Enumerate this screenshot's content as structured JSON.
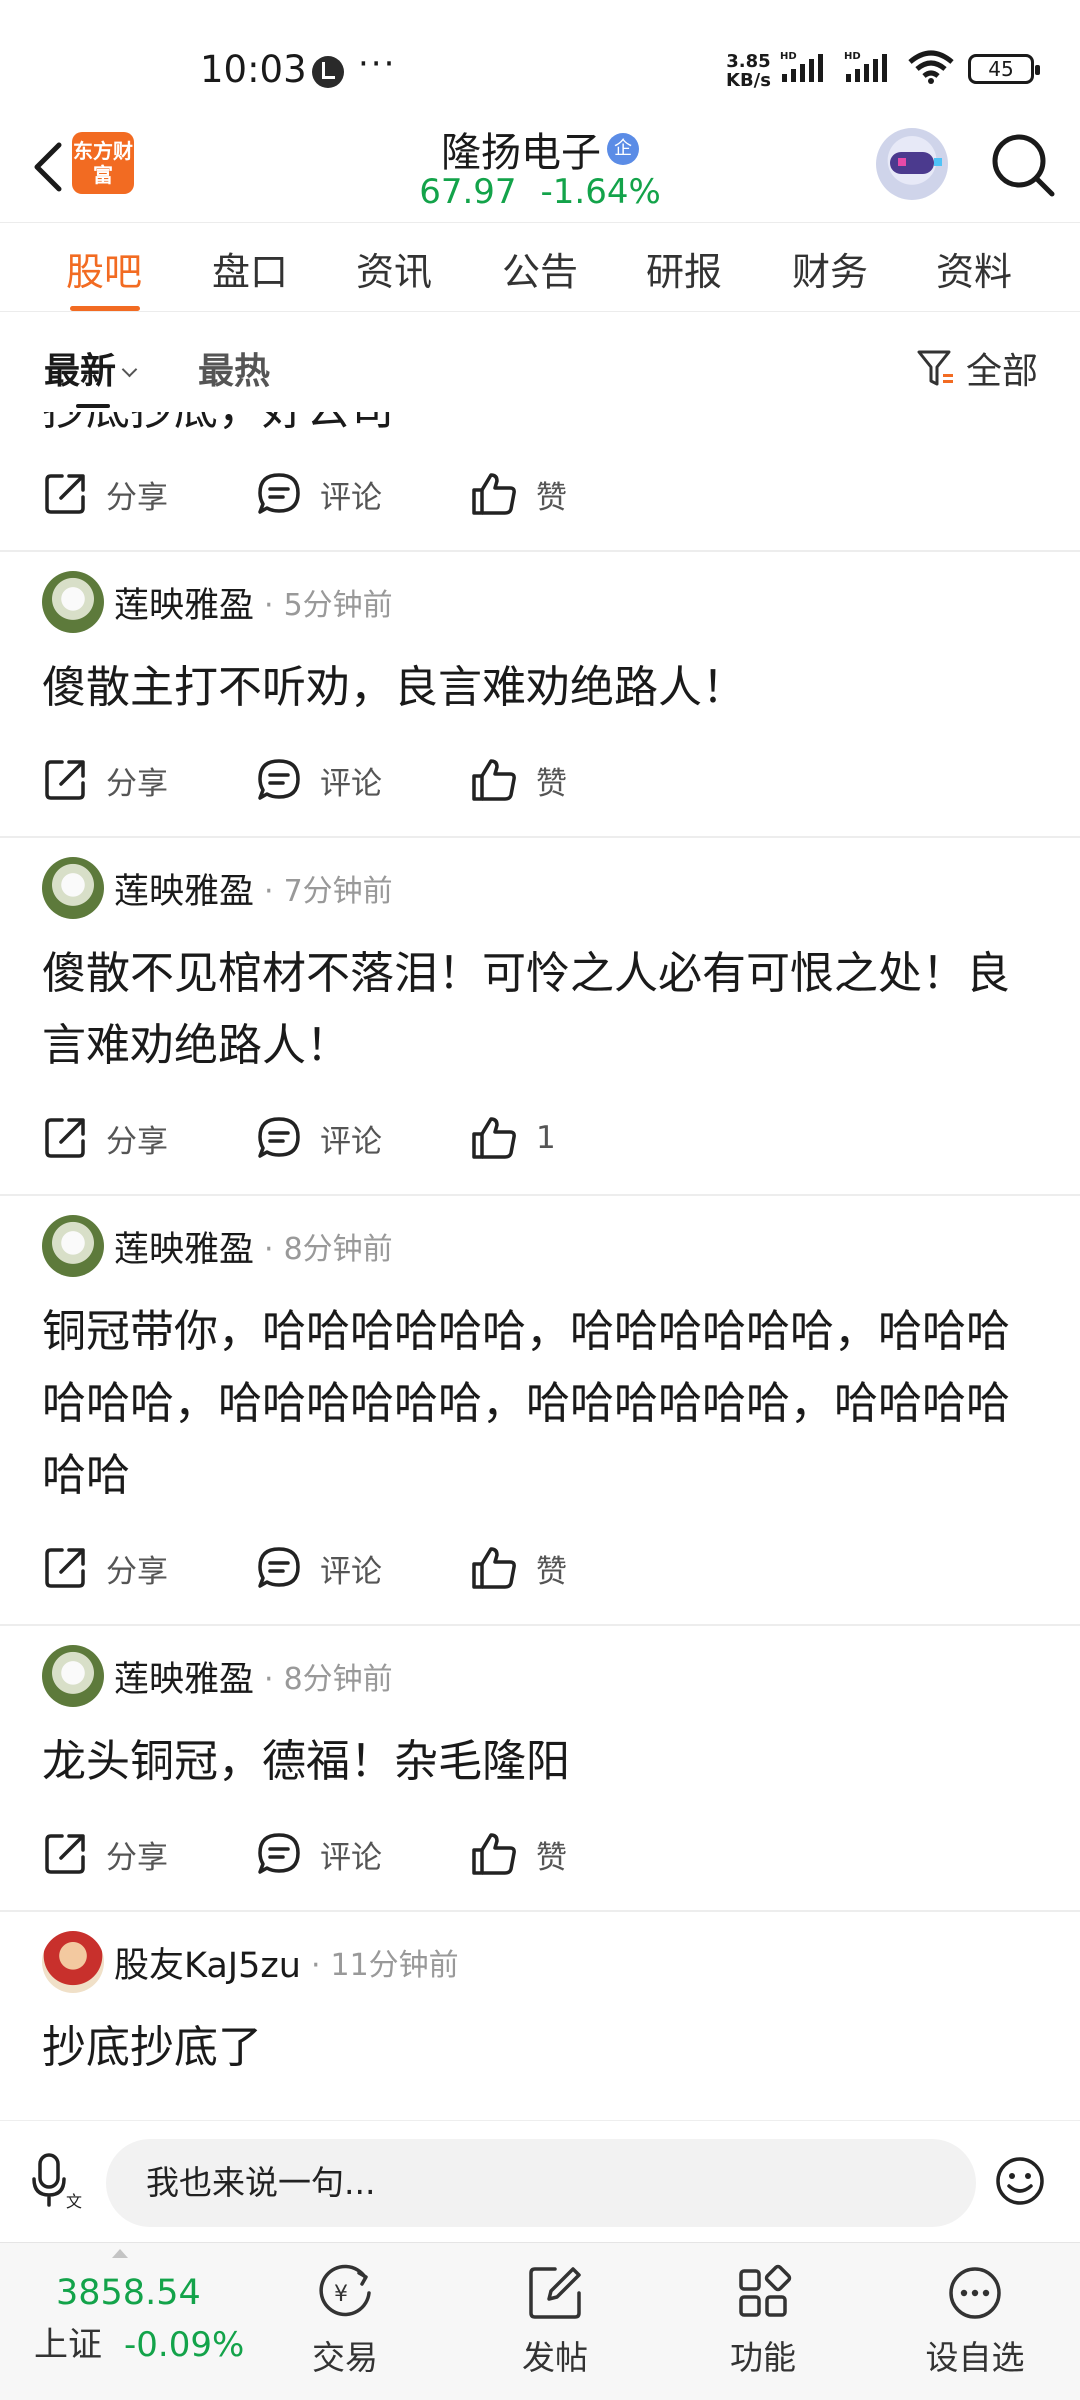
{
  "status_bar": {
    "time": "10:03",
    "more": "···",
    "speed_value": "3.85",
    "speed_unit": "KB/s",
    "battery": "45"
  },
  "header": {
    "logo_text": "东方财富",
    "stock_name": "隆扬电子",
    "badge": "企",
    "price": "67.97",
    "change": "-1.64%"
  },
  "tabs": [
    "股吧",
    "盘口",
    "资讯",
    "公告",
    "研报",
    "财务",
    "资料"
  ],
  "sort": {
    "latest": "最新",
    "hottest": "最热",
    "filter": "全部"
  },
  "actions": {
    "share": "分享",
    "comment": "评论",
    "like": "赞"
  },
  "posts": [
    {
      "author": "",
      "time": "",
      "body": "抄底抄底，好公司",
      "likes": "赞"
    },
    {
      "author": "莲映雅盈",
      "time": "5分钟前",
      "body": "傻散主打不听劝，良言难劝绝路人！",
      "likes": "赞"
    },
    {
      "author": "莲映雅盈",
      "time": "7分钟前",
      "body": "傻散不见棺材不落泪！可怜之人必有可恨之处！良言难劝绝路人！",
      "likes": "1"
    },
    {
      "author": "莲映雅盈",
      "time": "8分钟前",
      "body": "铜冠带你，哈哈哈哈哈哈，哈哈哈哈哈哈，哈哈哈哈哈哈，哈哈哈哈哈哈，哈哈哈哈哈哈，哈哈哈哈哈哈",
      "likes": "赞"
    },
    {
      "author": "莲映雅盈",
      "time": "8分钟前",
      "body": "龙头铜冠，德福！杂毛隆阳",
      "likes": "赞"
    },
    {
      "author": "股友KaJ5zu",
      "time": "11分钟前",
      "body": "抄底抄底了",
      "likes": "赞"
    }
  ],
  "comment_bar": {
    "placeholder": "我也来说一句..."
  },
  "bottom_nav": {
    "index_value": "3858.54",
    "index_name": "上证",
    "index_change": "-0.09%",
    "items": [
      "交易",
      "发帖",
      "功能",
      "设自选"
    ]
  }
}
